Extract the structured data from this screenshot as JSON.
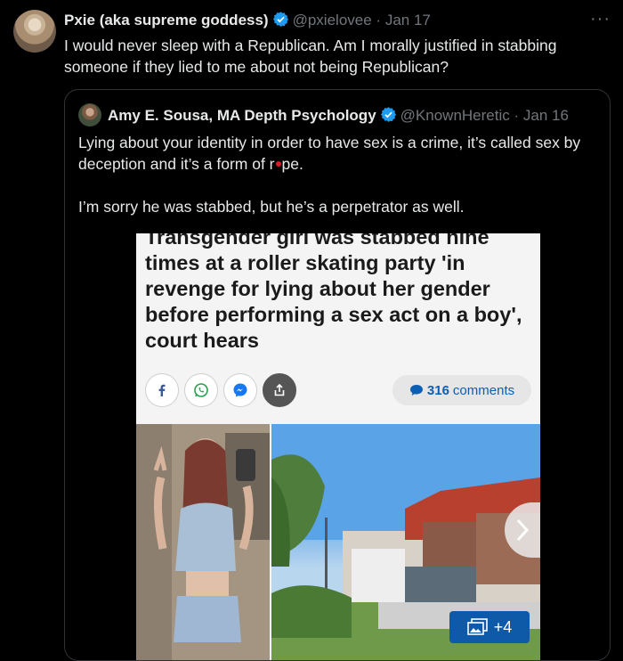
{
  "tweet": {
    "author_name": "Pxie (aka supreme goddess)",
    "author_handle": "@pxielovee",
    "separator": "·",
    "date": "Jan 17",
    "text": "I would never sleep with a Republican. Am I morally justified in stabbing someone if they lied to me about not being Republican?"
  },
  "quote": {
    "author_name": "Amy E. Sousa, MA Depth Psychology",
    "author_handle": "@KnownHeretic",
    "separator": "·",
    "date": "Jan 16",
    "text_para1_a": "Lying about your identity in order to have sex is a crime, it’s called sex by deception and it’s a form of r",
    "text_para1_b": "pe.",
    "text_para2": "I’m sorry he was stabbed, but he’s a perpetrator as well."
  },
  "article": {
    "headline": "Transgender girl was stabbed nine times at a roller skating party 'in revenge for lying about her gender before performing a sex act on a boy', court hears",
    "comments_count": "316",
    "comments_label": "comments",
    "gallery_more": "+4"
  },
  "icons": [
    "verified-badge-icon",
    "more-options-icon",
    "facebook-icon",
    "whatsapp-icon",
    "messenger-icon",
    "share-icon",
    "comment-bubble-icon",
    "chevron-right-icon",
    "gallery-icon"
  ],
  "colors": {
    "background": "#000000",
    "text": "#e7e9ea",
    "secondary_text": "#71767b",
    "verified": "#1d9bf0",
    "border": "#2f3336",
    "comments_link": "#0b5fb5"
  }
}
